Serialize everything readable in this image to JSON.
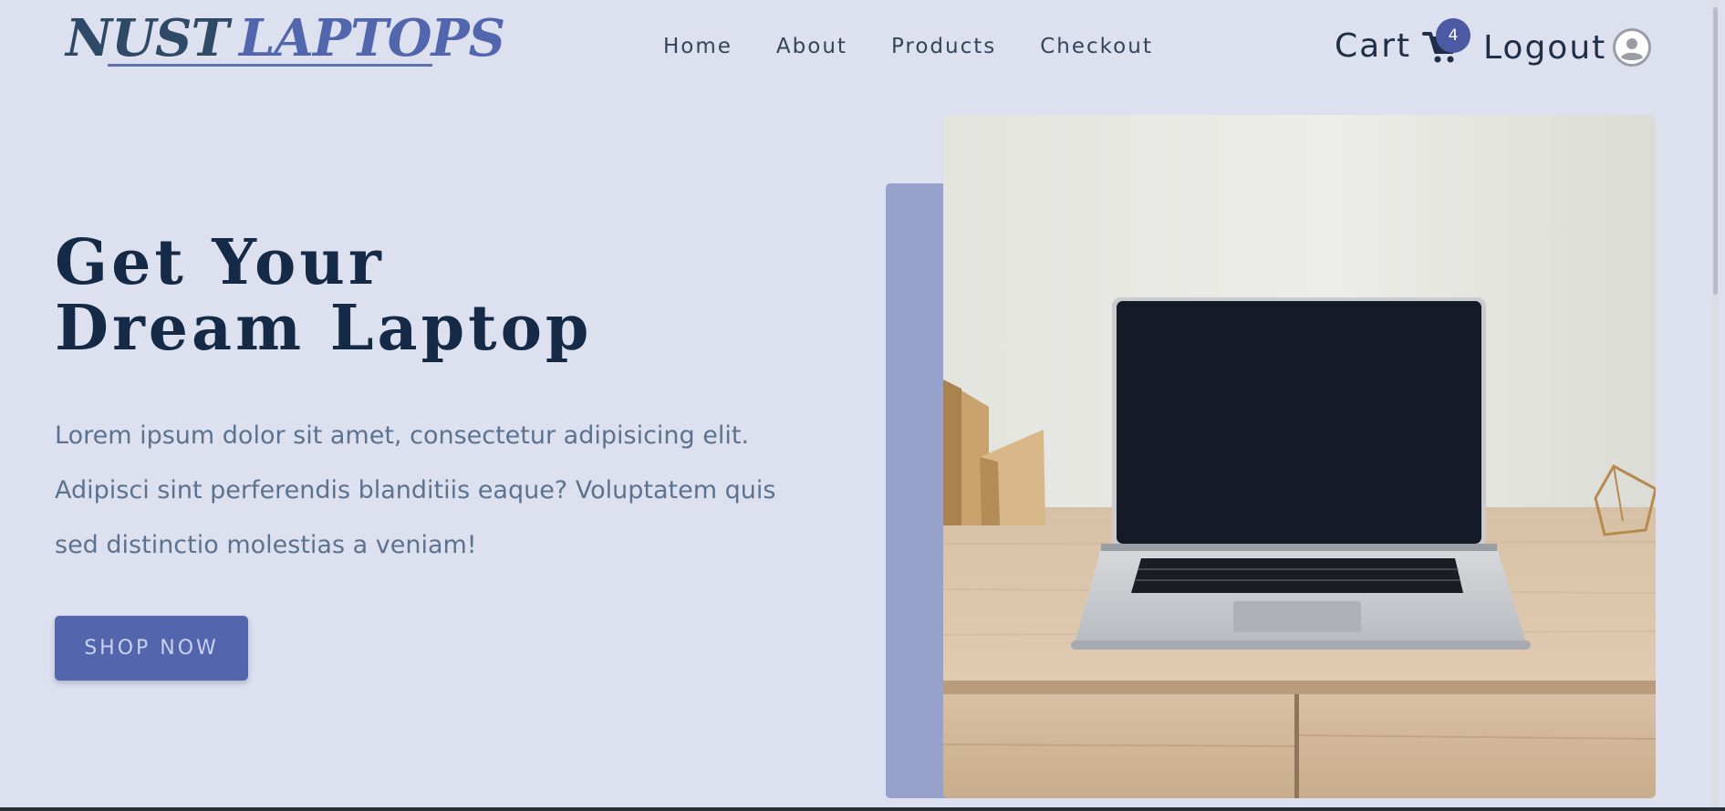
{
  "brand": {
    "part1": "NUST",
    "part2": "LAPTOPS"
  },
  "nav": {
    "home": "Home",
    "about": "About",
    "products": "Products",
    "checkout": "Checkout"
  },
  "cart": {
    "label": "Cart",
    "count": "4",
    "icon": "shopping-cart-icon"
  },
  "account": {
    "logout_label": "Logout",
    "icon": "user-circle-icon"
  },
  "hero": {
    "title_line1": "Get Your",
    "title_line2": "Dream Laptop",
    "description": "Lorem ipsum dolor sit amet, consectetur adipisicing elit. Adipisci sint perferendis blanditiis eaque? Voluptatem quis sed distinctio molestias a veniam!",
    "cta_label": "SHOP NOW"
  },
  "colors": {
    "background": "#dde0ee",
    "accent": "#5366ad",
    "heading": "#142a46",
    "body_text": "#5b7391",
    "deco_block": "#96a2cc"
  }
}
